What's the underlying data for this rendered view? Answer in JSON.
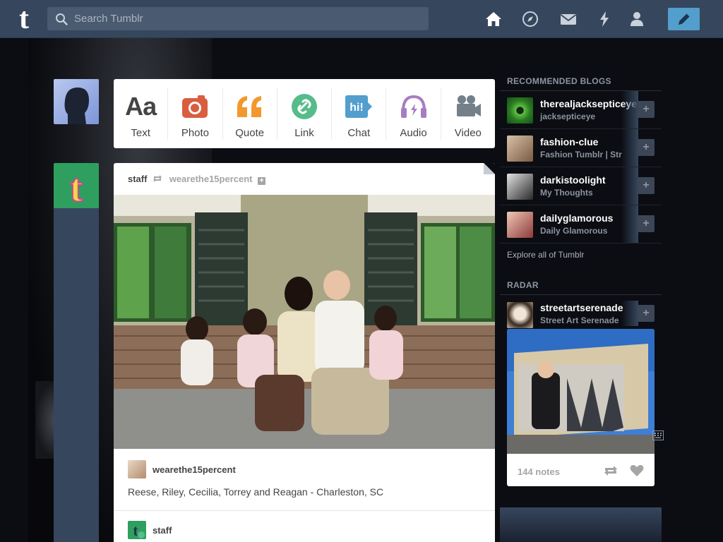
{
  "header": {
    "logo": "t",
    "search_placeholder": "Search Tumblr",
    "nav_icons": [
      "home-icon",
      "explore-compass-icon",
      "inbox-mail-icon",
      "activity-lightning-icon",
      "account-person-icon"
    ],
    "compose_icon": "pencil-icon"
  },
  "post_types": [
    {
      "label": "Text",
      "icon": "text-aa-icon",
      "color": "#444444"
    },
    {
      "label": "Photo",
      "icon": "camera-icon",
      "color": "#d95e40"
    },
    {
      "label": "Quote",
      "icon": "quote-icon",
      "color": "#f2992e"
    },
    {
      "label": "Link",
      "icon": "link-icon",
      "color": "#56bc8a"
    },
    {
      "label": "Chat",
      "icon": "chat-bubble-icon",
      "color": "#529ecc"
    },
    {
      "label": "Audio",
      "icon": "headphones-icon",
      "color": "#a77dc2"
    },
    {
      "label": "Video",
      "icon": "video-camera-icon",
      "color": "#748089"
    }
  ],
  "chat_icon_text": "hi!",
  "post": {
    "blog": "staff",
    "reblogged_from": "wearethe15percent",
    "source_blog": "wearethe15percent",
    "caption": "Reese, Riley, Cecilia, Torrey and Reagan - Charleston, SC",
    "next_blog": "staff"
  },
  "sidebar": {
    "recommended_title": "RECOMMENDED BLOGS",
    "recommended": [
      {
        "name": "therealjacksepticeye",
        "subtitle": "jacksepticeye"
      },
      {
        "name": "fashion-clue",
        "subtitle": "Fashion Tumblr | Str"
      },
      {
        "name": "darkistoolight",
        "subtitle": "My Thoughts"
      },
      {
        "name": "dailyglamorous",
        "subtitle": "Daily Glamorous"
      }
    ],
    "follow_symbol": "+",
    "explore_link": "Explore all of Tumblr",
    "radar_title": "RADAR",
    "radar": {
      "name": "streetartserenade",
      "subtitle": "Street Art Serenade",
      "notes": "144 notes"
    }
  },
  "colors": {
    "header_bg": "#36465d",
    "accent": "#529ecc",
    "page_bg": "#0b0d12"
  }
}
